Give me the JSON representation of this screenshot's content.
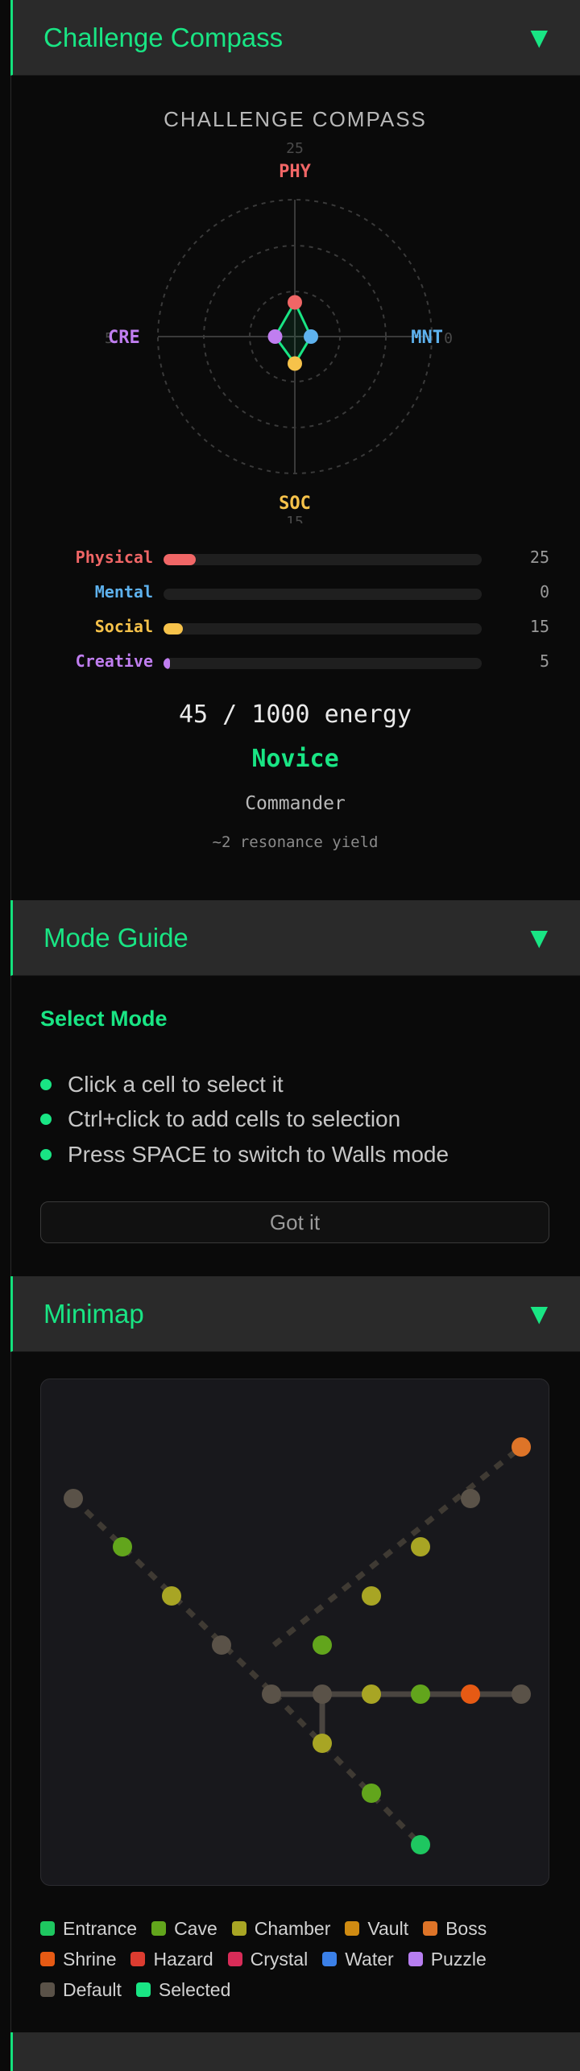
{
  "panels": {
    "compass": {
      "title": "Challenge Compass",
      "chevron": "▼"
    },
    "mode_guide": {
      "title": "Mode Guide",
      "chevron": "▼"
    },
    "minimap": {
      "title": "Minimap",
      "chevron": "▼"
    }
  },
  "compass": {
    "title": "CHALLENGE COMPASS",
    "axes": [
      {
        "key": "phy",
        "label": "PHY",
        "value": 25,
        "color": "#f06666"
      },
      {
        "key": "mnt",
        "label": "MNT",
        "value": 0,
        "color": "#5eb2ee"
      },
      {
        "key": "soc",
        "label": "SOC",
        "value": 15,
        "color": "#f6c24a"
      },
      {
        "key": "cre",
        "label": "CRE",
        "value": 5,
        "color": "#c07ef0"
      }
    ],
    "axis_top_value": "25",
    "axis_bottom_value": "15",
    "axis_left_cut": "5",
    "axis_right_cut": "0",
    "stats": [
      {
        "label": "Physical",
        "value": "25",
        "fraction": 0.1,
        "color": "#f06666"
      },
      {
        "label": "Mental",
        "value": "0",
        "fraction": 0.0,
        "color": "#5eb2ee"
      },
      {
        "label": "Social",
        "value": "15",
        "fraction": 0.06,
        "color": "#f6c24a"
      },
      {
        "label": "Creative",
        "value": "5",
        "fraction": 0.02,
        "color": "#c07ef0"
      }
    ],
    "energy": "45 / 1000 energy",
    "rank": "Novice",
    "rank_title": "Commander",
    "yield": "~2 resonance yield"
  },
  "mode_guide": {
    "heading": "Select Mode",
    "tips": [
      "Click a cell to select it",
      "Ctrl+click to add cells to selection",
      "Press SPACE to switch to Walls mode"
    ],
    "button": "Got it"
  },
  "minimap": {
    "legend_rows": [
      [
        {
          "label": "Entrance",
          "color": "#1ec760"
        },
        {
          "label": "Cave",
          "color": "#62a51c"
        },
        {
          "label": "Chamber",
          "color": "#a8a524"
        },
        {
          "label": "Vault",
          "color": "#cf8b12"
        },
        {
          "label": "Boss",
          "color": "#de7428"
        }
      ],
      [
        {
          "label": "Shrine",
          "color": "#e65a14"
        },
        {
          "label": "Hazard",
          "color": "#dc3c30"
        },
        {
          "label": "Crystal",
          "color": "#d82c58"
        },
        {
          "label": "Water",
          "color": "#3b80e8"
        },
        {
          "label": "Puzzle",
          "color": "#b77ef0"
        }
      ],
      [
        {
          "label": "Default",
          "color": "#5a5248"
        },
        {
          "label": "Selected",
          "color": "#19e584"
        }
      ]
    ]
  }
}
